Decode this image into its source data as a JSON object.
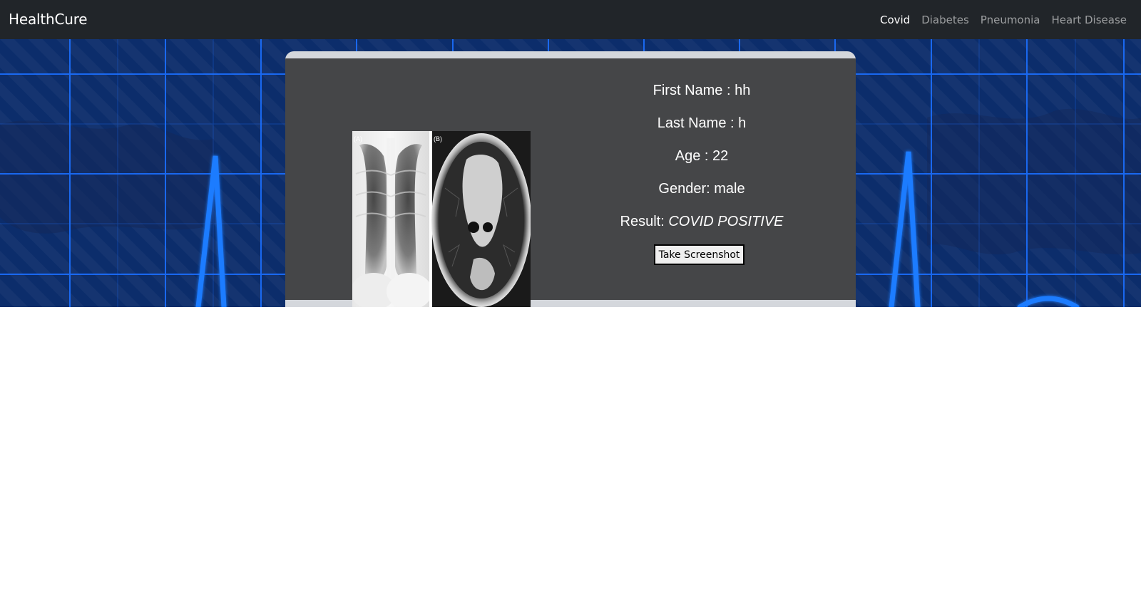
{
  "navbar": {
    "brand": "HealthCure",
    "items": [
      {
        "label": "Covid",
        "active": true
      },
      {
        "label": "Diabetes",
        "active": false
      },
      {
        "label": "Pneumonia",
        "active": false
      },
      {
        "label": "Heart Disease",
        "active": false
      }
    ]
  },
  "hero": {
    "background_icon": "ecg-heartbeat-grid",
    "colors": {
      "background": "#0c2d6b",
      "grid": "#1b6fff",
      "pulse": "#1f7bff"
    }
  },
  "result_card": {
    "image": {
      "icon": "chest-xray-ct-image",
      "panel_a_label": "(A)",
      "panel_b_label": "(B)"
    },
    "first_name": "First Name : hh",
    "last_name": "Last Name : h",
    "age": "Age : 22",
    "gender": "Gender: male",
    "result_label": "Result: ",
    "result_value": "COVID POSITIVE",
    "screenshot_button": "Take Screenshot"
  }
}
